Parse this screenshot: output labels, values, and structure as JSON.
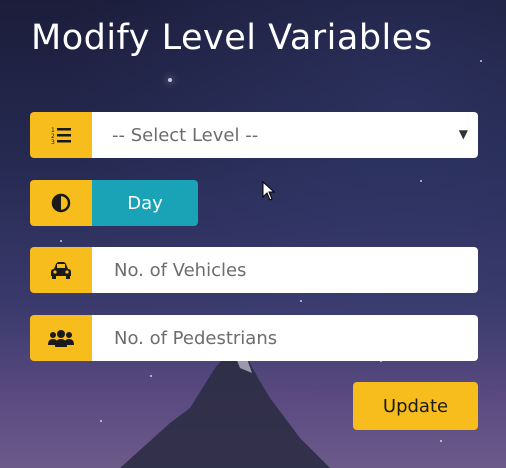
{
  "header": {
    "title": "Modify Level Variables"
  },
  "form": {
    "level_select": {
      "icon": "list-ol-icon",
      "value": "-- Select Level --"
    },
    "time_toggle": {
      "icon": "half-circle-contrast-icon",
      "label": "Day"
    },
    "vehicles": {
      "icon": "car-icon",
      "placeholder": "No. of Vehicles"
    },
    "pedestrians": {
      "icon": "users-icon",
      "placeholder": "No. of Pedestrians"
    },
    "update_label": "Update"
  },
  "colors": {
    "accent": "#f6bd1c",
    "toggle": "#1aa3b6",
    "title": "#ffffff"
  }
}
